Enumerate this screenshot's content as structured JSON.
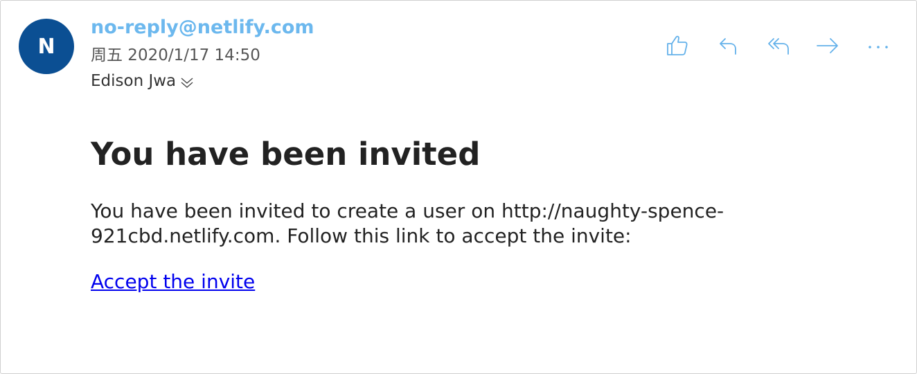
{
  "colors": {
    "avatar_bg": "#0b4f93",
    "sender": "#6cb8ee",
    "toolbar_icon": "#63b1ea",
    "link": "#0000ee"
  },
  "header": {
    "avatar_initial": "N",
    "sender": "no-reply@netlify.com",
    "date": "周五 2020/1/17 14:50",
    "recipient": "Edison Jwa"
  },
  "toolbar": {
    "icons": [
      "thumbs-up-icon",
      "reply-icon",
      "reply-all-icon",
      "forward-icon",
      "more-icon"
    ]
  },
  "message": {
    "heading": "You have been invited",
    "paragraph_line1": "You have been invited to create a user on http://naughty-spence-",
    "paragraph_line2": "921cbd.netlify.com. Follow this link to accept the invite:",
    "link_text": "Accept the invite"
  }
}
